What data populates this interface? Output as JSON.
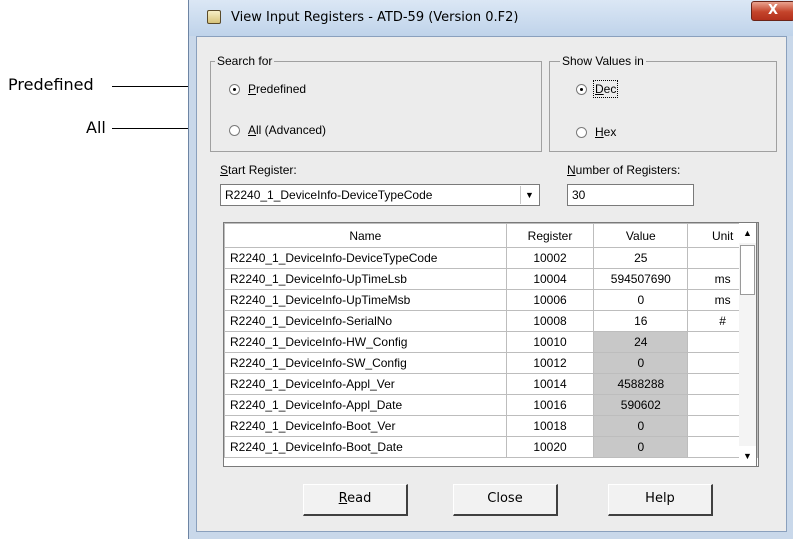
{
  "callouts": {
    "predefined": "Predefined",
    "all": "All"
  },
  "window": {
    "title": "View Input Registers - ATD-59 (Version 0.F2)",
    "close_glyph": "X"
  },
  "search_for": {
    "title": "Search for",
    "predefined": {
      "hotkey": "P",
      "rest": "redefined",
      "checked": true
    },
    "all": {
      "hotkey": "A",
      "rest": "ll (Advanced)",
      "checked": false
    }
  },
  "show_values_in": {
    "title": "Show Values in",
    "dec": {
      "hotkey": "D",
      "rest": "ec",
      "checked": true
    },
    "hex": {
      "hotkey": "H",
      "rest": "ex",
      "checked": false
    }
  },
  "start_register": {
    "label_hotkey": "S",
    "label_rest": "tart Register:",
    "value": "R2240_1_DeviceInfo-DeviceTypeCode"
  },
  "number_of_registers": {
    "label_hotkey": "N",
    "label_rest": "umber of Registers:",
    "value": "30"
  },
  "table": {
    "headers": {
      "name": "Name",
      "register": "Register",
      "value": "Value",
      "unit": "Unit"
    },
    "rows": [
      {
        "name": "R2240_1_DeviceInfo-DeviceTypeCode",
        "register": "10002",
        "value": "25",
        "unit": "",
        "readonly": false
      },
      {
        "name": "R2240_1_DeviceInfo-UpTimeLsb",
        "register": "10004",
        "value": "594507690",
        "unit": "ms",
        "readonly": false
      },
      {
        "name": "R2240_1_DeviceInfo-UpTimeMsb",
        "register": "10006",
        "value": "0",
        "unit": "ms",
        "readonly": false
      },
      {
        "name": "R2240_1_DeviceInfo-SerialNo",
        "register": "10008",
        "value": "16",
        "unit": "#",
        "readonly": false
      },
      {
        "name": "R2240_1_DeviceInfo-HW_Config",
        "register": "10010",
        "value": "24",
        "unit": "",
        "readonly": true
      },
      {
        "name": "R2240_1_DeviceInfo-SW_Config",
        "register": "10012",
        "value": "0",
        "unit": "",
        "readonly": true
      },
      {
        "name": "R2240_1_DeviceInfo-Appl_Ver",
        "register": "10014",
        "value": "4588288",
        "unit": "",
        "readonly": true
      },
      {
        "name": "R2240_1_DeviceInfo-Appl_Date",
        "register": "10016",
        "value": "590602",
        "unit": "",
        "readonly": true
      },
      {
        "name": "R2240_1_DeviceInfo-Boot_Ver",
        "register": "10018",
        "value": "0",
        "unit": "",
        "readonly": true
      },
      {
        "name": "R2240_1_DeviceInfo-Boot_Date",
        "register": "10020",
        "value": "0",
        "unit": "",
        "readonly": true
      }
    ]
  },
  "buttons": {
    "read": {
      "hotkey": "R",
      "rest": "ead"
    },
    "close": "Close",
    "help": "Help"
  },
  "icons": {
    "dropdown": "▼",
    "scroll_up": "▲",
    "scroll_down": "▼"
  }
}
